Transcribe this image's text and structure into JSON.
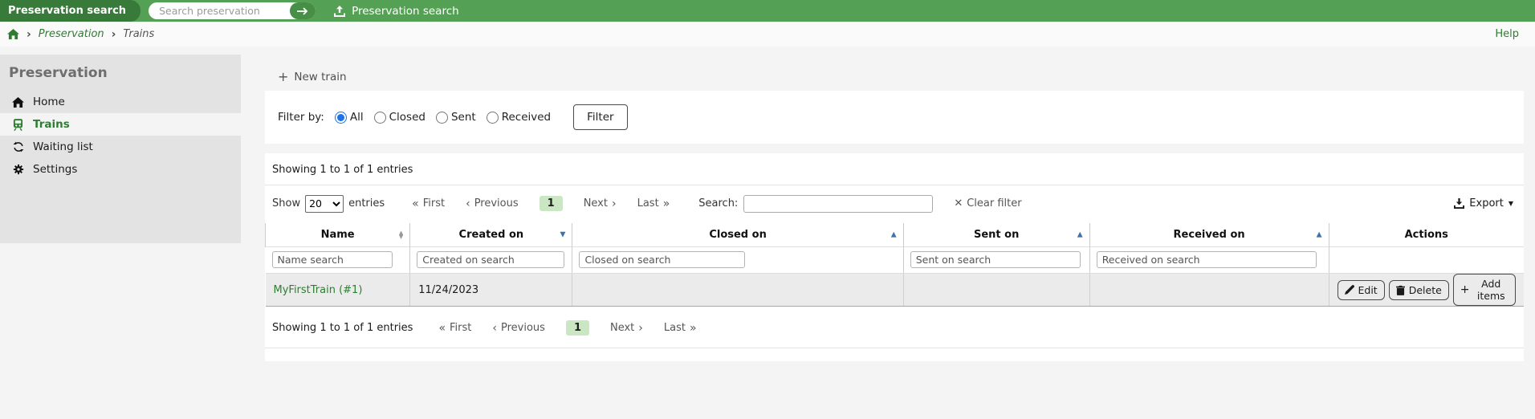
{
  "topbar": {
    "brand_label": "Preservation search",
    "search_placeholder": "Search preservation",
    "section_label": "Preservation search"
  },
  "breadcrumb": {
    "items": [
      "Preservation",
      "Trains"
    ],
    "help_label": "Help"
  },
  "sidebar": {
    "title": "Preservation",
    "items": [
      {
        "label": "Home",
        "icon": "home-icon",
        "active": false
      },
      {
        "label": "Trains",
        "icon": "train-icon",
        "active": true
      },
      {
        "label": "Waiting list",
        "icon": "recycle-icon",
        "active": false
      },
      {
        "label": "Settings",
        "icon": "gear-icon",
        "active": false
      }
    ]
  },
  "content": {
    "new_train_label": "New train",
    "filter": {
      "label": "Filter by:",
      "options": [
        "All",
        "Closed",
        "Sent",
        "Received"
      ],
      "selected": "All",
      "button_label": "Filter"
    },
    "summary_top": "Showing 1 to 1 of 1 entries",
    "summary_bottom": "Showing 1 to 1 of 1 entries",
    "controls": {
      "show_label": "Show",
      "page_size": "20",
      "entries_label": "entries",
      "search_label": "Search:",
      "search_value": "",
      "clear_filter_label": "Clear filter",
      "export_label": "Export"
    },
    "pagination": {
      "first": "First",
      "previous": "Previous",
      "page": "1",
      "next": "Next",
      "last": "Last"
    },
    "table": {
      "columns": [
        {
          "label": "Name",
          "sort": "unsorted",
          "placeholder": "Name search"
        },
        {
          "label": "Created on",
          "sort": "desc",
          "placeholder": "Created on search"
        },
        {
          "label": "Closed on",
          "sort": "asc",
          "placeholder": "Closed on search"
        },
        {
          "label": "Sent on",
          "sort": "asc",
          "placeholder": "Sent on search"
        },
        {
          "label": "Received on",
          "sort": "asc",
          "placeholder": "Received on search"
        },
        {
          "label": "Actions",
          "sort": "none",
          "placeholder": ""
        }
      ],
      "rows": [
        {
          "name": "MyFirstTrain (#1)",
          "created_on": "11/24/2023",
          "closed_on": "",
          "sent_on": "",
          "received_on": "",
          "actions": [
            "Edit",
            "Delete",
            "Add items"
          ]
        }
      ]
    }
  },
  "colors": {
    "topbar_green": "#54a054",
    "brand_tab_green": "#377a39",
    "accent_green": "#2e7d32",
    "active_page_bg": "#cbe6c3",
    "radio_blue": "#1a73e8",
    "sort_arrow_blue": "#3d72aa"
  }
}
